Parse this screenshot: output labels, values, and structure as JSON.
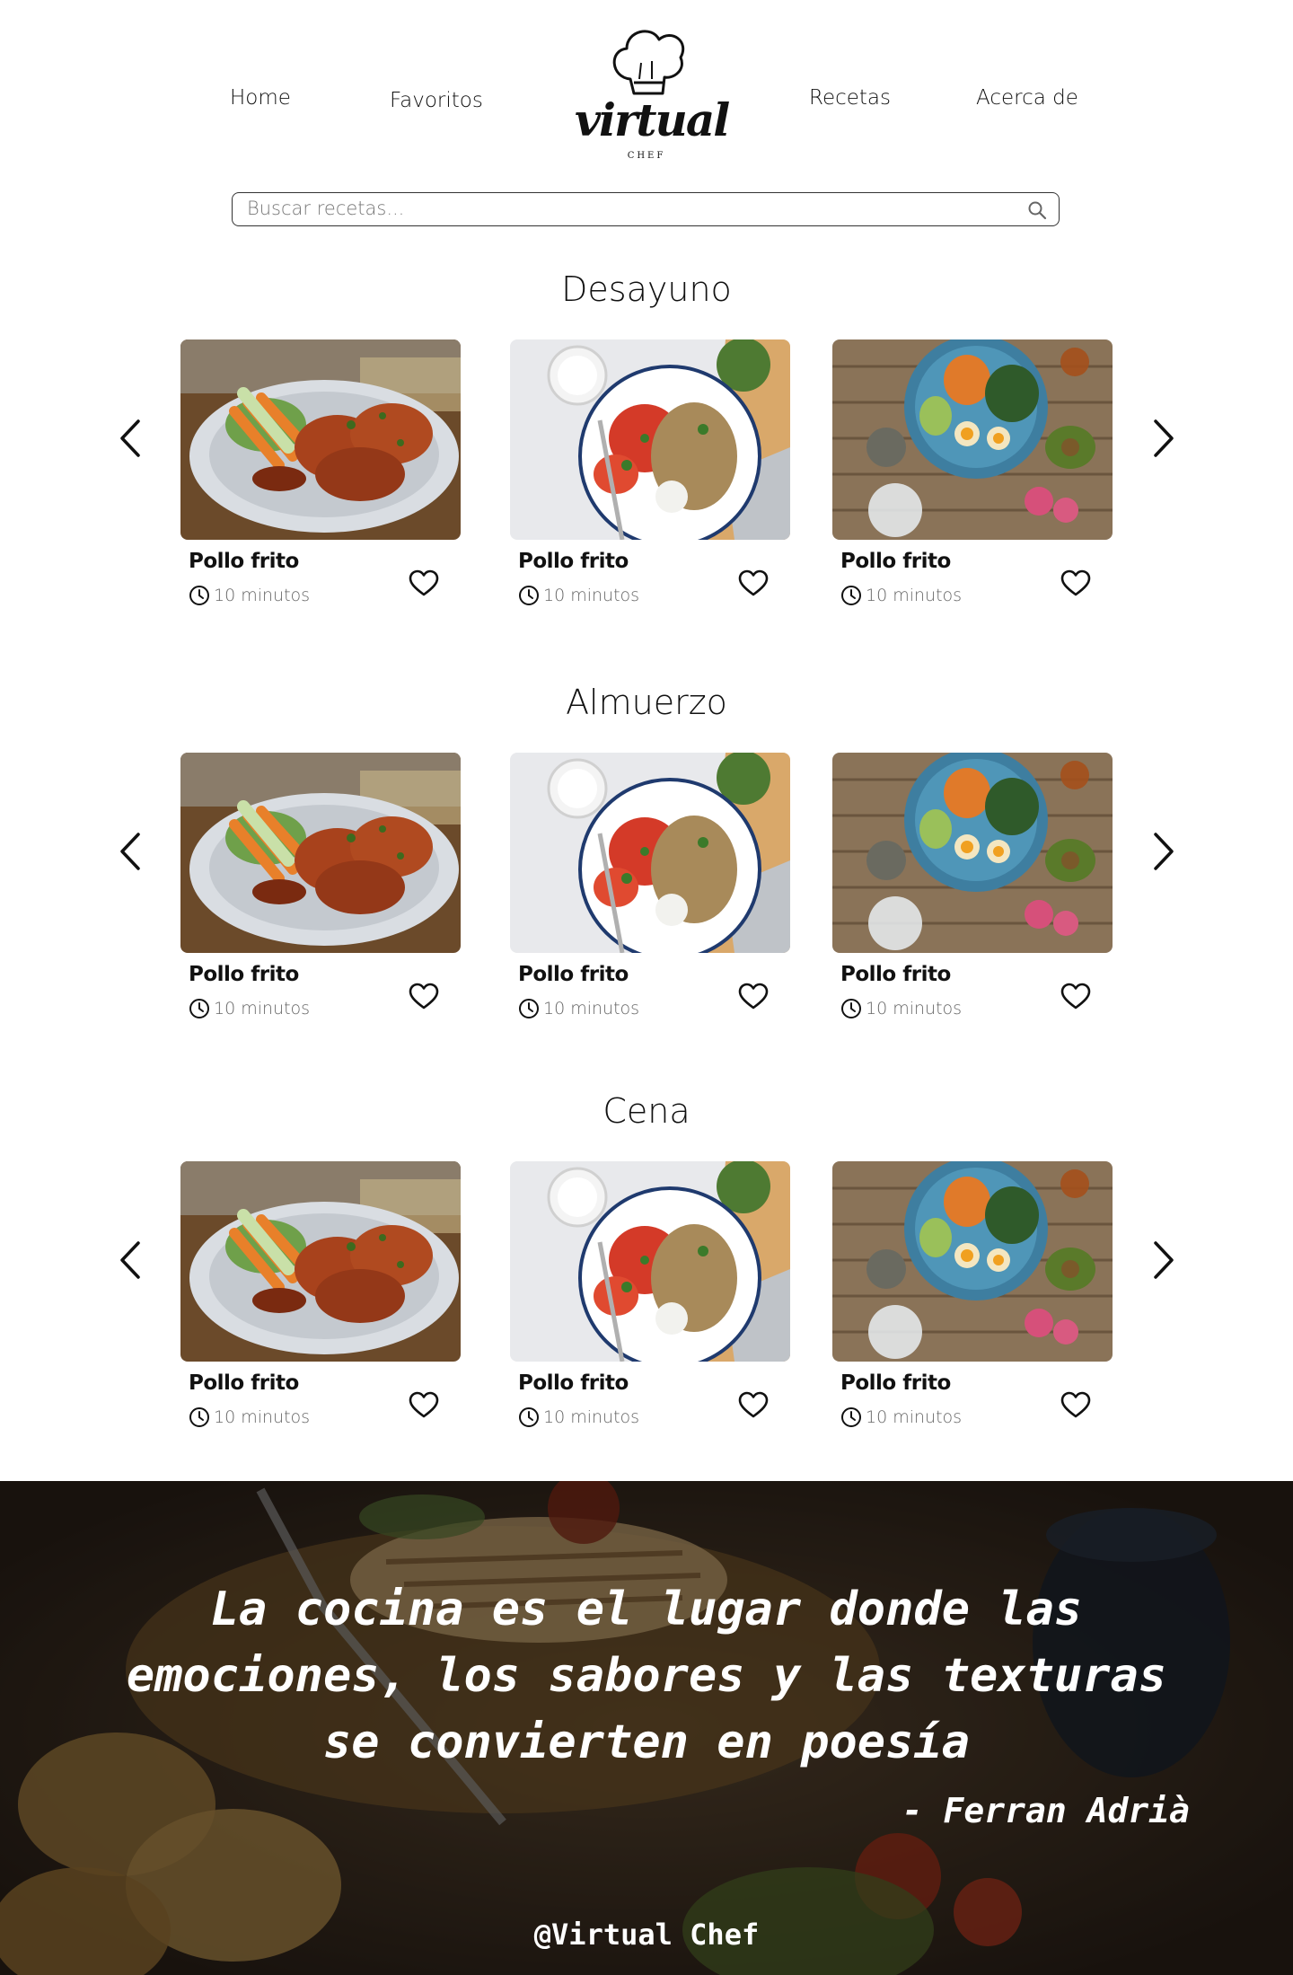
{
  "header": {
    "nav_left": [
      "Home",
      "Favoritos"
    ],
    "nav_right": [
      "Recetas",
      "Acerca de"
    ],
    "logo": {
      "word": "virtual",
      "sub": "CHEF"
    }
  },
  "search": {
    "placeholder": "Buscar recetas..."
  },
  "sections": [
    {
      "title": "Desayuno",
      "cards": [
        {
          "name": "Pollo frito",
          "time": "10 minutos",
          "image": "chicken-wings-photo"
        },
        {
          "name": "Pollo frito",
          "time": "10 minutos",
          "image": "salad-plate-photo"
        },
        {
          "name": "Pollo frito",
          "time": "10 minutos",
          "image": "bowl-table-photo"
        }
      ]
    },
    {
      "title": "Almuerzo",
      "cards": [
        {
          "name": "Pollo frito",
          "time": "10 minutos",
          "image": "chicken-wings-photo"
        },
        {
          "name": "Pollo frito",
          "time": "10 minutos",
          "image": "salad-plate-photo"
        },
        {
          "name": "Pollo frito",
          "time": "10 minutos",
          "image": "bowl-table-photo"
        }
      ]
    },
    {
      "title": "Cena",
      "cards": [
        {
          "name": "Pollo frito",
          "time": "10 minutos",
          "image": "chicken-wings-photo"
        },
        {
          "name": "Pollo frito",
          "time": "10 minutos",
          "image": "salad-plate-photo"
        },
        {
          "name": "Pollo frito",
          "time": "10 minutos",
          "image": "bowl-table-photo"
        }
      ]
    }
  ],
  "footer": {
    "quote": "La cocina es el lugar donde las\nemociones, los sabores y las texturas\nse convierten en poesía",
    "author": "- Ferran Adrià",
    "handle": "@Virtual Chef"
  },
  "icons": {
    "search": "search-icon",
    "prev": "chevron-left-icon",
    "next": "chevron-right-icon",
    "time": "clock-icon",
    "favorite": "heart-icon"
  }
}
